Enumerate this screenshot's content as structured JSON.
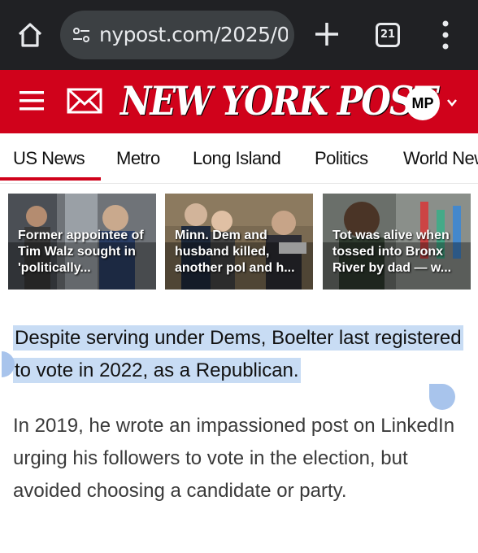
{
  "browser": {
    "url": "nypost.com/2025/0",
    "tab_count": "21"
  },
  "header": {
    "logo": "NEW YORK POST",
    "avatar_initials": "MP"
  },
  "nav": {
    "items": [
      "US News",
      "Metro",
      "Long Island",
      "Politics",
      "World News"
    ],
    "active": "US News"
  },
  "stories": [
    {
      "headline": "Former appointee of Tim Walz sought in 'politically..."
    },
    {
      "headline": "Minn. Dem and husband killed, another pol and h..."
    },
    {
      "headline": "Tot was alive when tossed into Bronx River by dad — w..."
    }
  ],
  "article": {
    "highlighted_paragraph": "Despite serving under Dems, Boelter last registered to vote in 2022, as a Republican.",
    "paragraph_2": "In 2019, he wrote an impassioned post on LinkedIn urging his followers to vote in the election, but avoided choosing a candidate or party."
  },
  "colors": {
    "brand_red": "#d0021b",
    "chrome_dark": "#202124",
    "selection_highlight": "#c8dcf4",
    "selection_handle": "#a8c4ec"
  },
  "icons": [
    "home-icon",
    "tune-icon",
    "plus-icon",
    "tab-switcher-icon",
    "more-vert-icon",
    "hamburger-icon",
    "mail-icon",
    "chevron-down-icon"
  ]
}
